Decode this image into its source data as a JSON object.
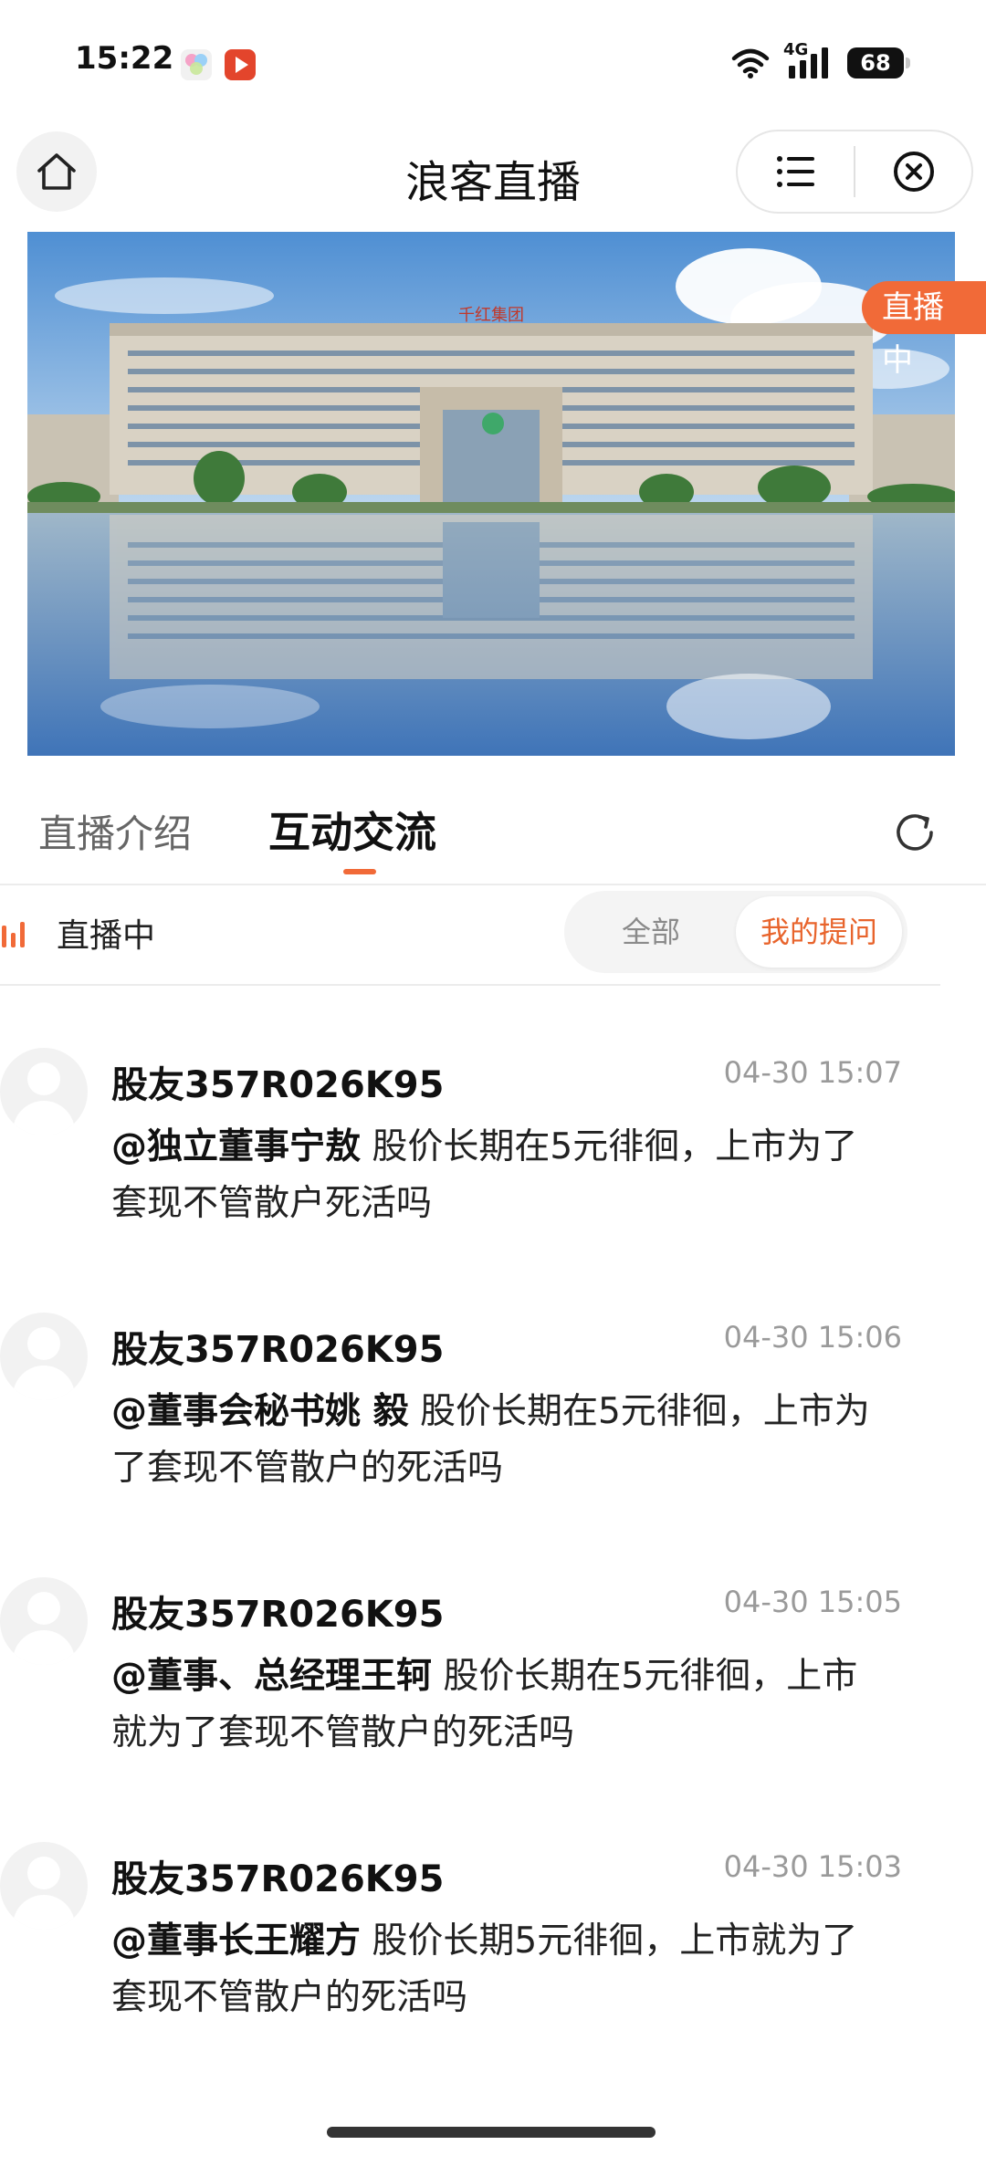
{
  "status_bar": {
    "time": "15:22",
    "network": "4G",
    "battery": "68"
  },
  "header": {
    "title": "浪客直播"
  },
  "banner": {
    "building_sign": "千红集团",
    "live_badge": "直播中"
  },
  "tabs": [
    {
      "label": "直播介绍",
      "active": false
    },
    {
      "label": "互动交流",
      "active": true
    }
  ],
  "filter": {
    "status": "直播中",
    "options": [
      {
        "label": "全部",
        "selected": false
      },
      {
        "label": "我的提问",
        "selected": true
      }
    ]
  },
  "posts": [
    {
      "user": "股友357R026K95",
      "time": "04-30 15:07",
      "mention": "@独立董事宁敖",
      "text": " 股价长期在5元徘徊，上市为了套现不管散户死活吗"
    },
    {
      "user": "股友357R026K95",
      "time": "04-30 15:06",
      "mention": "@董事会秘书姚 毅",
      "text": " 股价长期在5元徘徊，上市为了套现不管散户的死活吗"
    },
    {
      "user": "股友357R026K95",
      "time": "04-30 15:05",
      "mention": "@董事、总经理王轲",
      "text": " 股价长期在5元徘徊，上市就为了套现不管散户的死活吗"
    },
    {
      "user": "股友357R026K95",
      "time": "04-30 15:03",
      "mention": "@董事长王耀方",
      "text": " 股价长期5元徘徊，上市就为了套现不管散户的死活吗"
    }
  ],
  "colors": {
    "accent": "#f16a38",
    "text": "#111111",
    "muted": "#9a9a9a"
  }
}
